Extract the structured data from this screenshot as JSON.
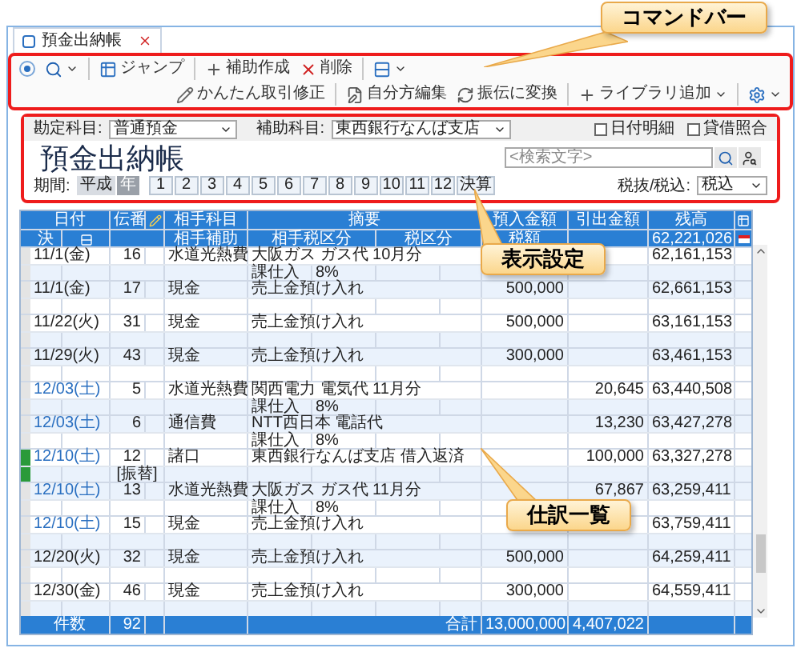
{
  "tab": {
    "label": "預金出納帳",
    "selected": true
  },
  "toolbar": {
    "items": [
      {
        "kind": "icon",
        "checked": true
      },
      {
        "kind": "icon",
        "dropdown": true
      },
      {
        "kind": "separator"
      },
      {
        "kind": "button",
        "label": "ジャンプ",
        "dropdown": false
      },
      {
        "kind": "separator"
      },
      {
        "kind": "button",
        "label": "補助作成",
        "dropdown": false
      },
      {
        "kind": "button",
        "label": "削除",
        "dropdown": false
      },
      {
        "kind": "separator"
      },
      {
        "kind": "icon",
        "dropdown": true
      },
      {
        "kind": "spacer"
      },
      {
        "kind": "button",
        "label": "かんたん取引修正",
        "dropdown": false
      },
      {
        "kind": "separator"
      },
      {
        "kind": "button",
        "label": "自分方編集",
        "dropdown": false
      },
      {
        "kind": "button",
        "label": "振伝に変換",
        "dropdown": false
      },
      {
        "kind": "separator"
      },
      {
        "kind": "button",
        "label": "ライブラリ追加",
        "dropdown": true
      },
      {
        "kind": "separator"
      },
      {
        "kind": "icon",
        "dropdown": true
      }
    ]
  },
  "settings": {
    "account_label": "勘定科目:",
    "account": "普通預金",
    "sub_account_label": "補助科目:",
    "sub_account": "東西銀行なんば支店",
    "checkboxes": [
      {
        "label": "日付明細",
        "checked": false
      },
      {
        "label": "貸借照合",
        "checked": false
      }
    ],
    "title": "預金出納帳",
    "search": {
      "placeholder": "<検索文字>"
    },
    "period_label": "期間:",
    "era": [
      {
        "label": "平成",
        "selected": false
      },
      {
        "label": "年",
        "selected": true
      }
    ],
    "months": [
      {
        "label": "1",
        "selected": false
      },
      {
        "label": "2",
        "selected": false
      },
      {
        "label": "3",
        "selected": false
      },
      {
        "label": "4",
        "selected": false
      },
      {
        "label": "5",
        "selected": false
      },
      {
        "label": "6",
        "selected": false
      },
      {
        "label": "7",
        "selected": false
      },
      {
        "label": "8",
        "selected": false
      },
      {
        "label": "9",
        "selected": false
      },
      {
        "label": "10",
        "selected": false
      },
      {
        "label": "11",
        "selected": false
      },
      {
        "label": "12",
        "selected": false
      },
      {
        "label": "決算",
        "selected": false
      }
    ],
    "tax_label": "税抜/税込:",
    "tax_mode": "税込"
  },
  "table": {
    "header1": {
      "date": "日付",
      "slip": "伝番",
      "account": "相手科目",
      "memo": "摘要",
      "deposit": "預入金額",
      "withdrawal": "引出金額",
      "balance": "残高"
    },
    "header2": {
      "settled": "決",
      "sub_account": "相手補助",
      "partner_tax": "相手税区分",
      "tax": "税区分",
      "tax_amount": "税額",
      "balance": "62,221,026"
    },
    "rows": [
      {
        "date": "11/1(金)",
        "saturday": false,
        "flagged": false,
        "slip": "16",
        "account": "水道光熱費",
        "memo": "大阪ガス ガス代 10月分",
        "deposit": "",
        "withdrawal": "",
        "balance": "62,161,153",
        "tax_class": "課仕入",
        "tax_rate": "8%",
        "tag": ""
      },
      {
        "date": "11/1(金)",
        "saturday": false,
        "flagged": false,
        "slip": "17",
        "account": "現金",
        "memo": "売上金預け入れ",
        "deposit": "500,000",
        "withdrawal": "",
        "balance": "62,661,153",
        "tax_class": "",
        "tax_rate": "",
        "tag": ""
      },
      {
        "date": "11/22(火)",
        "saturday": false,
        "flagged": false,
        "slip": "31",
        "account": "現金",
        "memo": "売上金預け入れ",
        "deposit": "500,000",
        "withdrawal": "",
        "balance": "63,161,153",
        "tax_class": "",
        "tax_rate": "",
        "tag": ""
      },
      {
        "date": "11/29(火)",
        "saturday": false,
        "flagged": false,
        "slip": "43",
        "account": "現金",
        "memo": "売上金預け入れ",
        "deposit": "300,000",
        "withdrawal": "",
        "balance": "63,461,153",
        "tax_class": "",
        "tax_rate": "",
        "tag": ""
      },
      {
        "date": "12/03(土)",
        "saturday": true,
        "flagged": false,
        "slip": "5",
        "account": "水道光熱費",
        "memo": "関西電力 電気代 11月分",
        "deposit": "",
        "withdrawal": "20,645",
        "balance": "63,440,508",
        "tax_class": "課仕入",
        "tax_rate": "8%",
        "tag": ""
      },
      {
        "date": "12/03(土)",
        "saturday": true,
        "flagged": false,
        "slip": "6",
        "account": "通信費",
        "memo": "NTT西日本 電話代",
        "deposit": "",
        "withdrawal": "13,230",
        "balance": "63,427,278",
        "tax_class": "課仕入",
        "tax_rate": "8%",
        "tag": ""
      },
      {
        "date": "12/10(土)",
        "saturday": true,
        "flagged": true,
        "slip": "12",
        "account": "諸口",
        "memo": "東西銀行なんば支店 借入返済",
        "deposit": "",
        "withdrawal": "100,000",
        "balance": "63,327,278",
        "tax_class": "",
        "tax_rate": "",
        "tag": "[振替]"
      },
      {
        "date": "12/10(土)",
        "saturday": true,
        "flagged": false,
        "slip": "13",
        "account": "水道光熱費",
        "memo": "大阪ガス ガス代 11月分",
        "deposit": "",
        "withdrawal": "67,867",
        "balance": "63,259,411",
        "tax_class": "課仕入",
        "tax_rate": "8%",
        "tag": ""
      },
      {
        "date": "12/10(土)",
        "saturday": true,
        "flagged": false,
        "slip": "15",
        "account": "現金",
        "memo": "売上金預け入れ",
        "deposit": "",
        "withdrawal": "",
        "balance": "63,759,411",
        "tax_class": "",
        "tax_rate": "",
        "tag": ""
      },
      {
        "date": "12/20(火)",
        "saturday": false,
        "flagged": false,
        "slip": "32",
        "account": "現金",
        "memo": "売上金預け入れ",
        "deposit": "500,000",
        "withdrawal": "",
        "balance": "64,259,411",
        "tax_class": "",
        "tax_rate": "",
        "tag": ""
      },
      {
        "date": "12/30(金)",
        "saturday": false,
        "flagged": false,
        "slip": "46",
        "account": "現金",
        "memo": "売上金預け入れ",
        "deposit": "300,000",
        "withdrawal": "",
        "balance": "64,559,411",
        "tax_class": "",
        "tax_rate": "",
        "tag": ""
      }
    ],
    "footer": {
      "count_label": "件数",
      "count": "92",
      "total_label": "合計",
      "deposit_total": "13,000,000",
      "withdrawal_total": "4,407,022"
    }
  },
  "callouts": [
    {
      "kind": "toolbar",
      "text": "コマンドバー"
    },
    {
      "kind": "settings",
      "text": "表示設定"
    },
    {
      "kind": "list",
      "text": "仕訳一覧"
    }
  ]
}
